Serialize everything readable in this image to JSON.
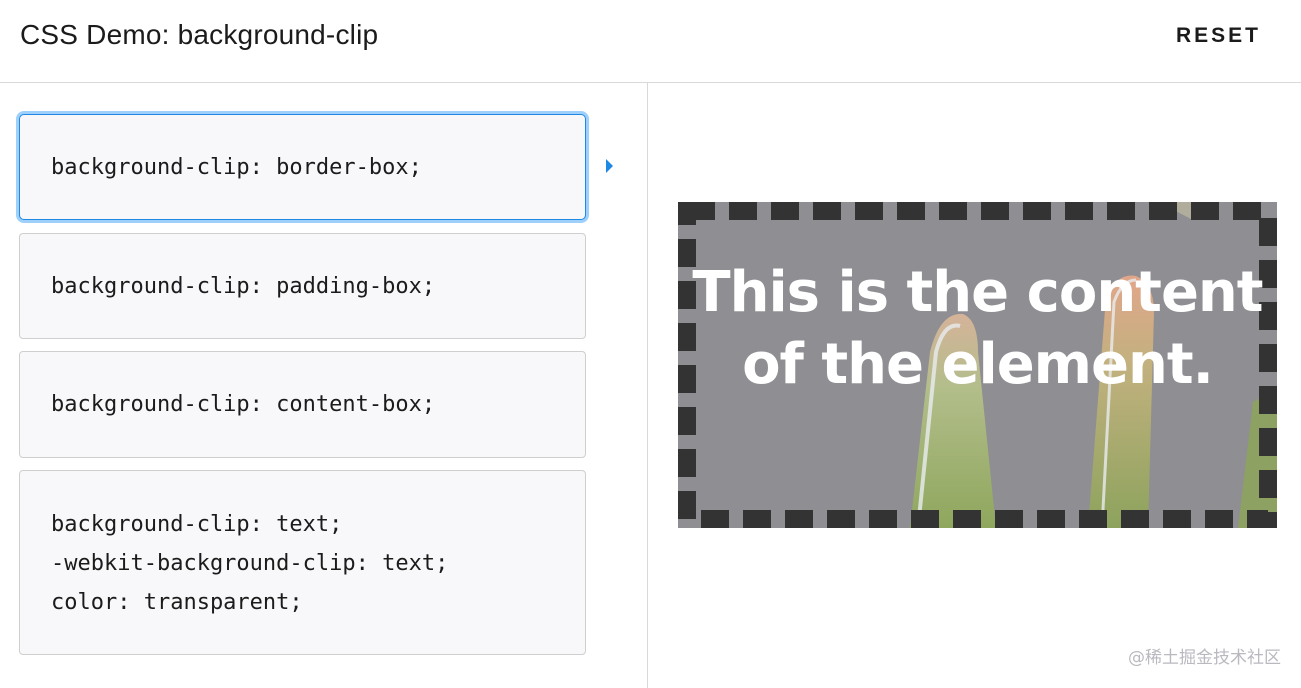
{
  "header": {
    "title": "CSS Demo: background-clip",
    "reset_label": "RESET"
  },
  "choices": [
    {
      "lines": [
        "background-clip: border-box;"
      ],
      "selected": true
    },
    {
      "lines": [
        "background-clip: padding-box;"
      ],
      "selected": false
    },
    {
      "lines": [
        "background-clip: content-box;"
      ],
      "selected": false
    },
    {
      "lines": [
        "background-clip: text;",
        "-webkit-background-clip: text;",
        "color: transparent;"
      ],
      "selected": false
    }
  ],
  "output": {
    "text": "This is the content of the element.",
    "border_color": "#333333",
    "background_color": "#8a8b8f"
  },
  "watermark": "@稀土掘金技术社区",
  "colors": {
    "accent": "#1e88e5",
    "focus_ring": "#9fd0fb"
  }
}
